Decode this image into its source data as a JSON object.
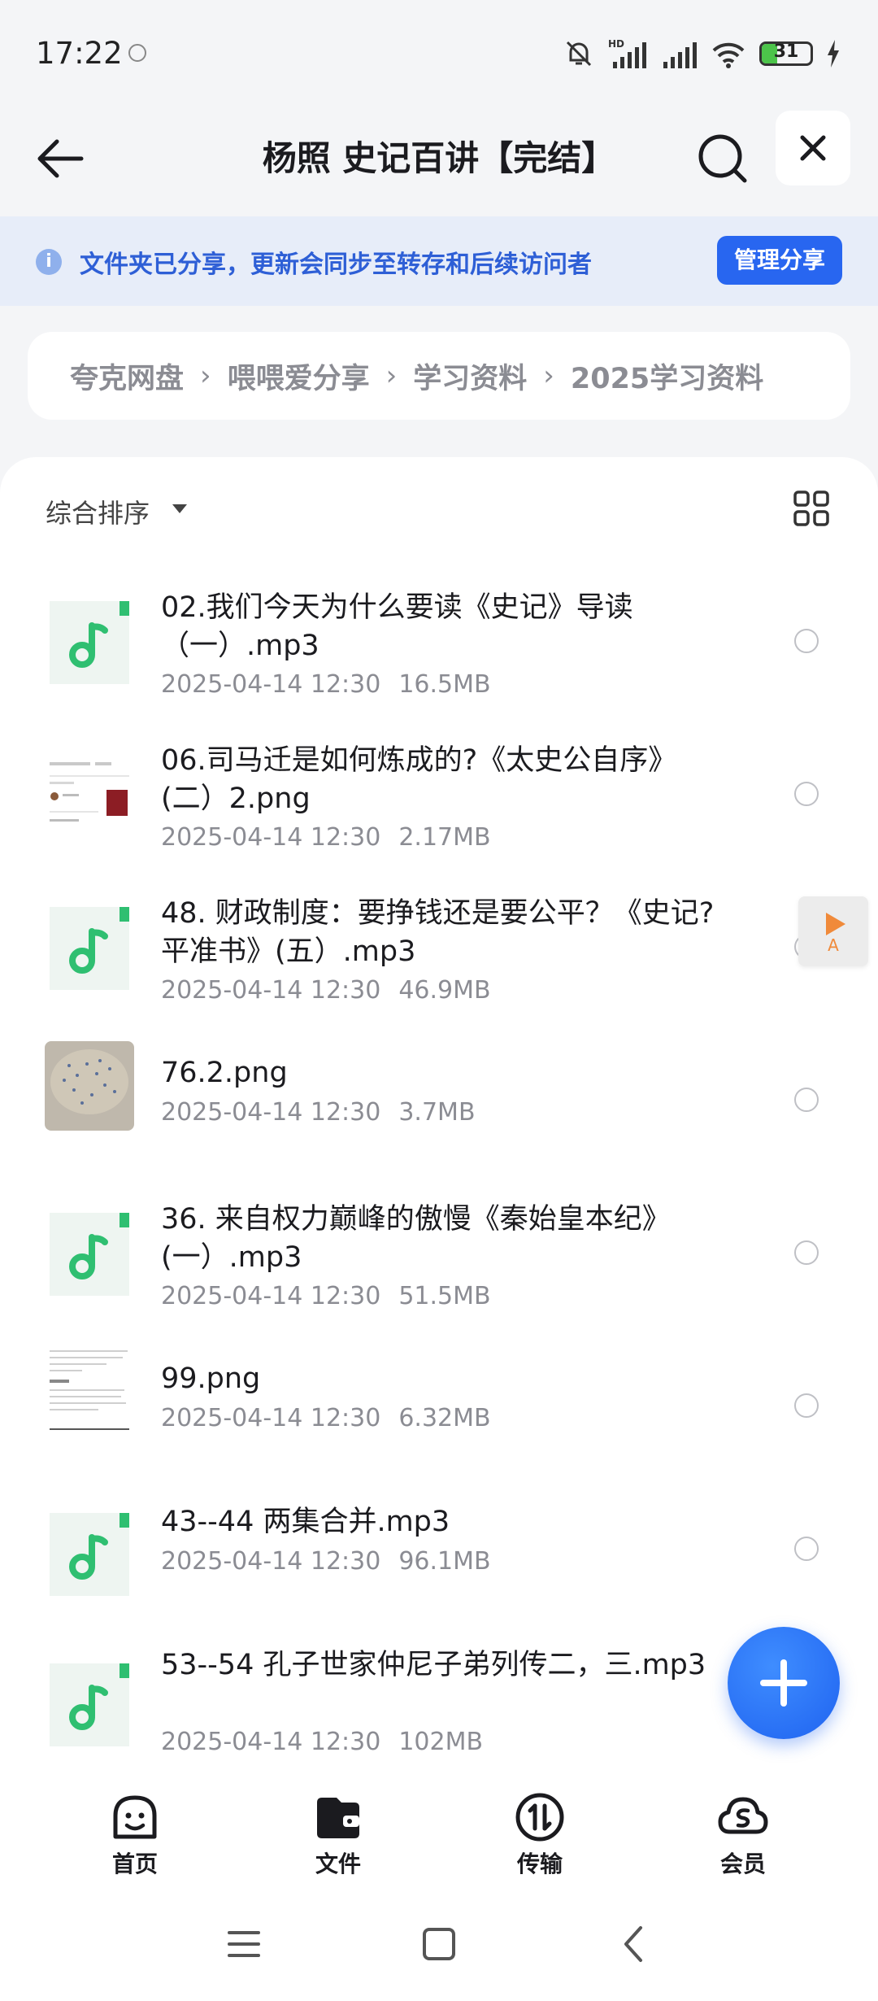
{
  "status_bar": {
    "time": "17:22",
    "signal_label": "HD",
    "battery_level": 0.31,
    "battery_text": "31"
  },
  "header": {
    "title": "杨照 史记百讲【完结】",
    "back_icon": "arrow-left-icon",
    "search_icon": "search-icon",
    "close_icon": "close-icon"
  },
  "share_banner": {
    "message": "文件夹已分享，更新会同步至转存和后续访问者",
    "manage_label": "管理分享"
  },
  "breadcrumb": [
    "夸克网盘",
    "喂喂爱分享",
    "学习资料",
    "2025学习资料"
  ],
  "list": {
    "sort_label": "综合排序",
    "files": [
      {
        "name": "02.我们今天为什么要读《史记》导读（一）.mp3",
        "date": "2025-04-14 12:30",
        "size": "16.5MB",
        "kind": "audio"
      },
      {
        "name": "06.司马迁是如何炼成的?《太史公自序》(二）2.png",
        "date": "2025-04-14 12:30",
        "size": "2.17MB",
        "kind": "image-doc"
      },
      {
        "name": "48. 财政制度：要挣钱还是要公平？《史记?平准书》(五）.mp3",
        "date": "2025-04-14 12:30",
        "size": "46.9MB",
        "kind": "audio"
      },
      {
        "name": "76.2.png",
        "date": "2025-04-14 12:30",
        "size": "3.7MB",
        "kind": "image-photo"
      },
      {
        "name": "36. 来自权力巅峰的傲慢《秦始皇本纪》(一）.mp3",
        "date": "2025-04-14 12:30",
        "size": "51.5MB",
        "kind": "audio"
      },
      {
        "name": "99.png",
        "date": "2025-04-14 12:30",
        "size": "6.32MB",
        "kind": "image-text"
      },
      {
        "name": "43--44 两集合并.mp3",
        "date": "2025-04-14 12:30",
        "size": "96.1MB",
        "kind": "audio"
      },
      {
        "name": "53--54 孔子世家仲尼子弟列传二，三.mp3",
        "date": "2025-04-14 12:30",
        "size": "102MB",
        "kind": "audio"
      }
    ]
  },
  "float_player": {
    "label": "A"
  },
  "bottom_nav": [
    {
      "label": "首页",
      "icon": "home-face-icon"
    },
    {
      "label": "文件",
      "icon": "folder-wallet-icon"
    },
    {
      "label": "传输",
      "icon": "transfer-icon"
    },
    {
      "label": "会员",
      "icon": "member-cloud-icon"
    }
  ],
  "colors": {
    "accent": "#2866f0",
    "banner_bg": "#e7edf9",
    "banner_text": "#2e5fd6",
    "audio_icon": "#2fbf71",
    "muted_text": "#8b8c93"
  }
}
